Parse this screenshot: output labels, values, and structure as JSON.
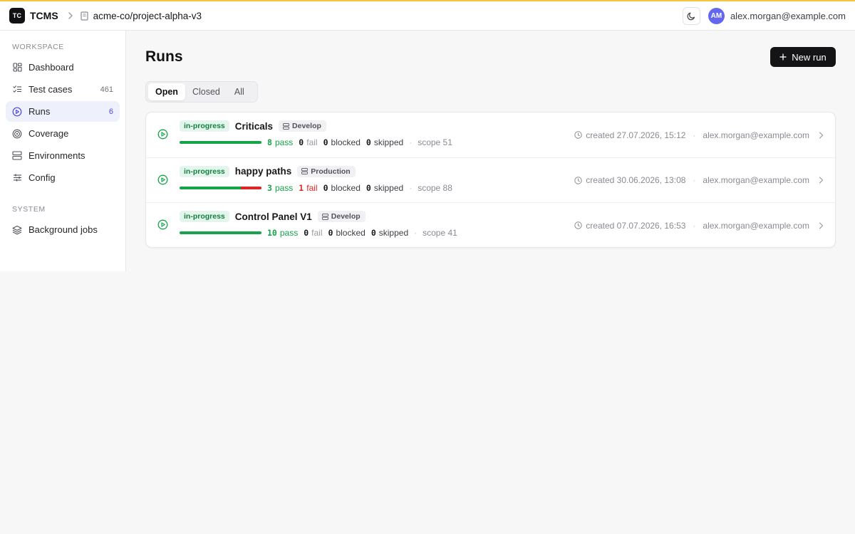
{
  "app": {
    "logo_text": "TC",
    "name": "TCMS"
  },
  "breadcrumb": {
    "repo": "acme-co/project-alpha-v3"
  },
  "user": {
    "initials": "AM",
    "email": "alex.morgan@example.com"
  },
  "colors": {
    "accent": "#4f46e5",
    "pass": "#16a34a",
    "fail": "#dc2626",
    "top_line": "#f5c542"
  },
  "sidebar": {
    "workspace_label": "WORKSPACE",
    "items": [
      {
        "label": "Dashboard",
        "count": "",
        "icon": "dashboard-icon"
      },
      {
        "label": "Test cases",
        "count": "461",
        "icon": "checklist-icon"
      },
      {
        "label": "Runs",
        "count": "6",
        "icon": "play-circle-icon",
        "active": true
      },
      {
        "label": "Coverage",
        "count": "",
        "icon": "target-icon"
      },
      {
        "label": "Environments",
        "count": "",
        "icon": "server-icon"
      },
      {
        "label": "Config",
        "count": "",
        "icon": "sliders-icon"
      }
    ],
    "system_label": "SYSTEM",
    "system_items": [
      {
        "label": "Background jobs",
        "icon": "layers-icon"
      }
    ]
  },
  "page": {
    "title": "Runs",
    "new_run_label": "New run",
    "tabs": [
      {
        "label": "Open",
        "active": true
      },
      {
        "label": "Closed"
      },
      {
        "label": "All"
      }
    ]
  },
  "runs": [
    {
      "status": "in-progress",
      "name": "Criticals",
      "environment": "Develop",
      "pass": "8",
      "pass_word": "pass",
      "fail": "0",
      "fail_word": "fail",
      "blocked": "0",
      "blocked_word": "blocked",
      "skipped": "0",
      "skipped_word": "skipped",
      "scope": "scope 51",
      "pass_fraction": 1.0,
      "fail_fraction": 0.0,
      "created": "created 27.07.2026, 15:12",
      "author": "alex.morgan@example.com"
    },
    {
      "status": "in-progress",
      "name": "happy paths",
      "environment": "Production",
      "pass": "3",
      "pass_word": "pass",
      "fail": "1",
      "fail_word": "fail",
      "blocked": "0",
      "blocked_word": "blocked",
      "skipped": "0",
      "skipped_word": "skipped",
      "scope": "scope 88",
      "pass_fraction": 0.75,
      "fail_fraction": 0.25,
      "created": "created 30.06.2026, 13:08",
      "author": "alex.morgan@example.com"
    },
    {
      "status": "in-progress",
      "name": "Control Panel V1",
      "environment": "Develop",
      "pass": "10",
      "pass_word": "pass",
      "fail": "0",
      "fail_word": "fail",
      "blocked": "0",
      "blocked_word": "blocked",
      "skipped": "0",
      "skipped_word": "skipped",
      "scope": "scope 41",
      "pass_fraction": 1.0,
      "fail_fraction": 0.0,
      "created": "created 07.07.2026, 16:53",
      "author": "alex.morgan@example.com"
    }
  ]
}
